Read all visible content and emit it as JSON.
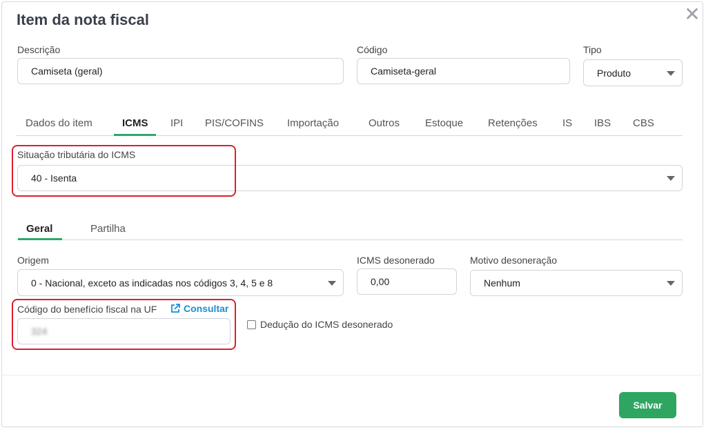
{
  "modal": {
    "title": "Item da nota fiscal"
  },
  "fields": {
    "descricao": {
      "label": "Descrição",
      "value": "Camiseta (geral)"
    },
    "codigo": {
      "label": "Código",
      "value": "Camiseta-geral"
    },
    "tipo": {
      "label": "Tipo",
      "value": "Produto"
    }
  },
  "tabs": [
    {
      "label": "Dados do item"
    },
    {
      "label": "ICMS",
      "active": true
    },
    {
      "label": "IPI"
    },
    {
      "label": "PIS/COFINS"
    },
    {
      "label": "Importação"
    },
    {
      "label": "Outros"
    },
    {
      "label": "Estoque"
    },
    {
      "label": "Retenções"
    },
    {
      "label": "IS"
    },
    {
      "label": "IBS"
    },
    {
      "label": "CBS"
    }
  ],
  "icms": {
    "situacao": {
      "label": "Situação tributária do ICMS",
      "value": "40 - Isenta"
    }
  },
  "subtabs": [
    {
      "label": "Geral",
      "active": true
    },
    {
      "label": "Partilha"
    }
  ],
  "geral": {
    "origem": {
      "label": "Origem",
      "value": "0 - Nacional, exceto as indicadas nos códigos 3, 4, 5 e 8"
    },
    "icms_desonerado": {
      "label": "ICMS desonerado",
      "value": "0,00"
    },
    "motivo": {
      "label": "Motivo desoneração",
      "value": "Nenhum"
    },
    "beneficio": {
      "label": "Código do benefício fiscal na UF",
      "link": "Consultar",
      "value": "324"
    },
    "deducao": {
      "label": "Dedução do ICMS desonerado",
      "checked": false
    }
  },
  "footer": {
    "save_label": "Salvar"
  },
  "colors": {
    "accent": "#2fa562",
    "highlight": "#d9202c",
    "link": "#1a8fd6"
  },
  "icons": {
    "close": "close-icon",
    "external": "external-link-icon",
    "caret": "chevron-down-icon"
  }
}
